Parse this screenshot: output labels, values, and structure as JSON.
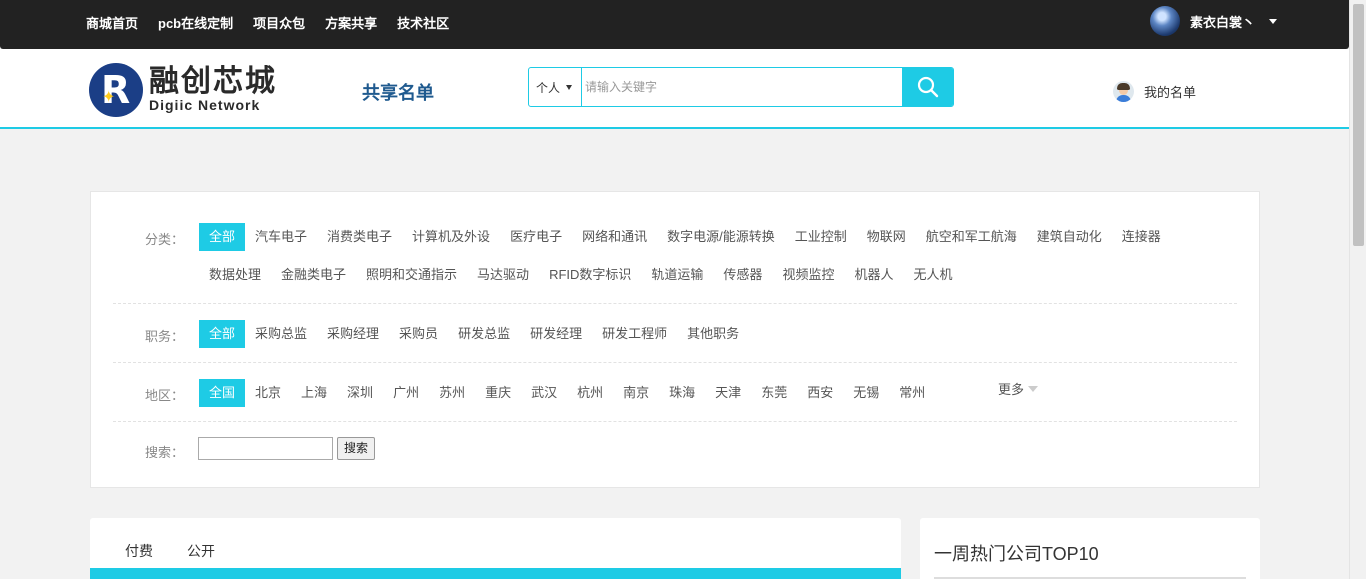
{
  "topbar": {
    "nav": [
      "商城首页",
      "pcb在线定制",
      "项目众包",
      "方案共享",
      "技术社区"
    ],
    "user_name": "素衣白裳丶"
  },
  "header": {
    "logo_cn": "融创芯城",
    "logo_en": "Digiic Network",
    "page_title": "共享名单",
    "search": {
      "scope": "个人",
      "placeholder": "请输入关键字"
    },
    "my_list": "我的名单"
  },
  "filters": {
    "category": {
      "label": "分类：",
      "items": [
        "全部",
        "汽车电子",
        "消费类电子",
        "计算机及外设",
        "医疗电子",
        "网络和通讯",
        "数字电源/能源转换",
        "工业控制",
        "物联网",
        "航空和军工航海",
        "建筑自动化",
        "连接器",
        "数据处理",
        "金融类电子",
        "照明和交通指示",
        "马达驱动",
        "RFID数字标识",
        "轨道运输",
        "传感器",
        "视频监控",
        "机器人",
        "无人机"
      ],
      "active": 0
    },
    "position": {
      "label": "职务：",
      "items": [
        "全部",
        "采购总监",
        "采购经理",
        "采购员",
        "研发总监",
        "研发经理",
        "研发工程师",
        "其他职务"
      ],
      "active": 0
    },
    "region": {
      "label": "地区：",
      "items": [
        "全国",
        "北京",
        "上海",
        "深圳",
        "广州",
        "苏州",
        "重庆",
        "武汉",
        "杭州",
        "南京",
        "珠海",
        "天津",
        "东莞",
        "西安",
        "无锡",
        "常州"
      ],
      "active": 0,
      "more_label": "更多"
    },
    "keyword": {
      "label": "搜索：",
      "value": "",
      "button": "搜索"
    }
  },
  "list": {
    "tabs": [
      "付费",
      "公开"
    ]
  },
  "hot": {
    "title": "一周热门公司TOP10"
  },
  "colors": {
    "accent": "#1ecbe5",
    "topbar": "#222222",
    "title_blue": "#1f5a8f"
  }
}
